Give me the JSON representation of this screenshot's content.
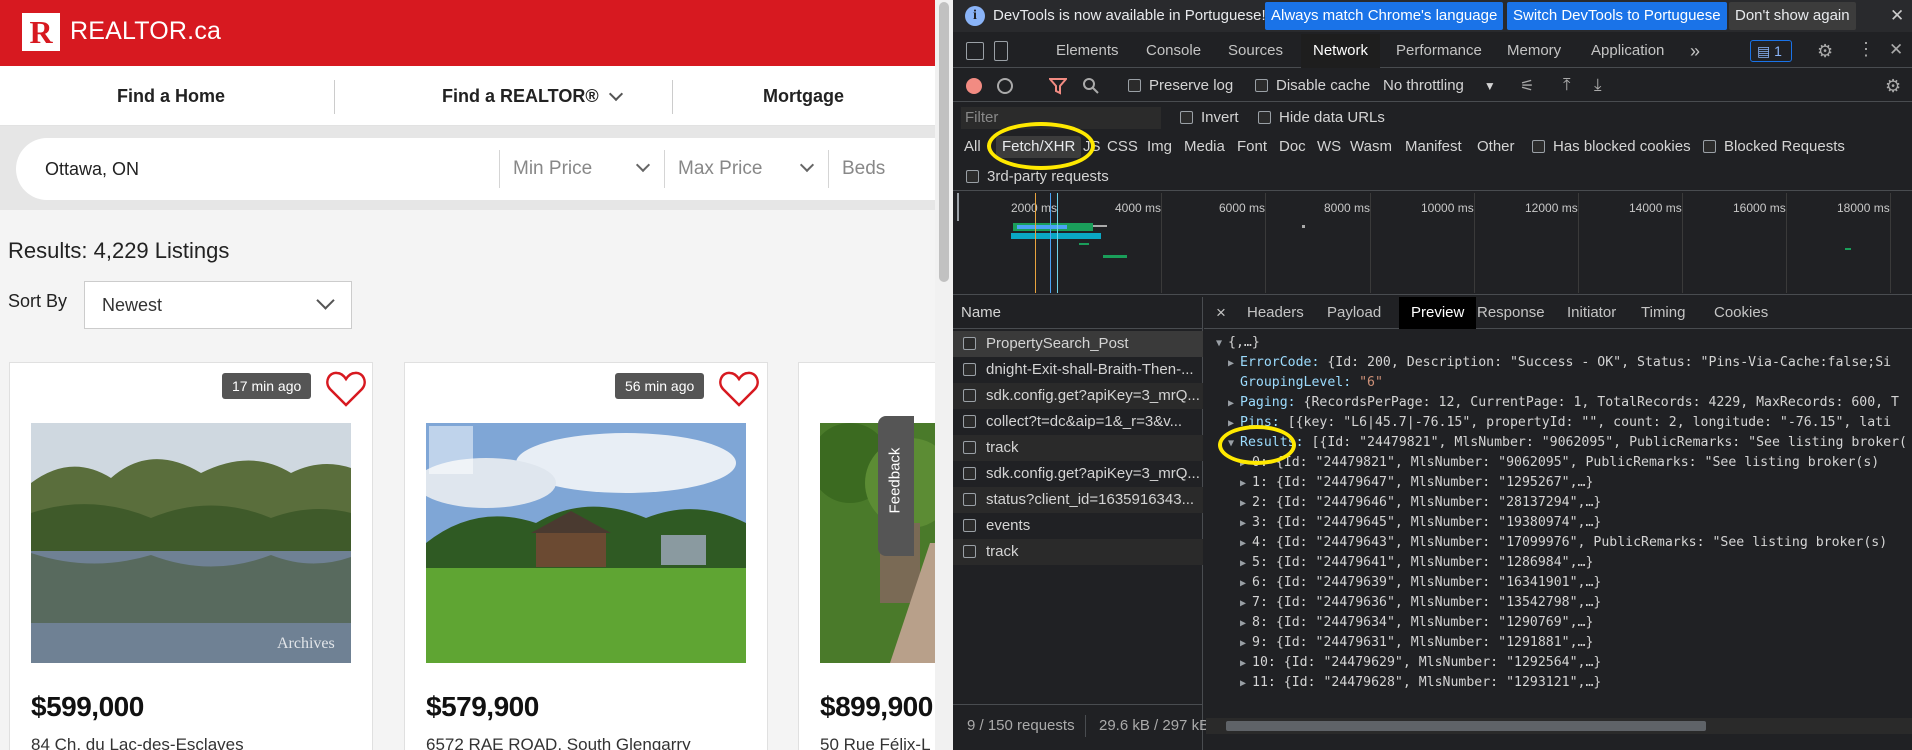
{
  "site": {
    "logo_letter": "R",
    "logo_text": "REALTOR.ca",
    "nav": [
      "Find a Home",
      "Find a REALTOR®",
      "Mortgage Calculators"
    ],
    "search": {
      "location": "Ottawa, ON",
      "min_price": "Min Price",
      "max_price": "Max Price",
      "beds": "Beds"
    },
    "results_label": "Results:",
    "results_count": "4,229 Listings",
    "sort_by_label": "Sort By",
    "sort_value": "Newest",
    "feedback": "Feedback",
    "listings": [
      {
        "time": "17 min ago",
        "price": "$599,000",
        "address": "84 Ch. du Lac-des-Esclaves",
        "watermark": "Archives"
      },
      {
        "time": "56 min ago",
        "price": "$579,900",
        "address": "6572 RAE ROAD, South Glengarry"
      },
      {
        "time": "",
        "price": "$899,900",
        "address": "50 Rue Félix-L"
      }
    ]
  },
  "devtools": {
    "info_icon": "i",
    "info_message": "DevTools is now available in Portuguese!",
    "btn_match": "Always match Chrome's language",
    "btn_switch": "Switch DevTools to Portuguese",
    "btn_dont_show": "Don't show again",
    "tabs": [
      "Elements",
      "Console",
      "Sources",
      "Network",
      "Performance",
      "Memory",
      "Application"
    ],
    "more_tabs": "»",
    "issues_count": "1",
    "preserve_log": "Preserve log",
    "disable_cache": "Disable cache",
    "throttling": "No throttling",
    "filter_placeholder": "Filter",
    "invert": "Invert",
    "hide_data_urls": "Hide data URLs",
    "types": [
      "All",
      "Fetch/XHR",
      "JS",
      "CSS",
      "Img",
      "Media",
      "Font",
      "Doc",
      "WS",
      "Wasm",
      "Manifest",
      "Other"
    ],
    "has_blocked_cookies": "Has blocked cookies",
    "blocked_requests": "Blocked Requests",
    "third_party": "3rd-party requests",
    "timeline_labels": [
      "2000 ms",
      "4000 ms",
      "6000 ms",
      "8000 ms",
      "10000 ms",
      "12000 ms",
      "14000 ms",
      "16000 ms",
      "18000 ms"
    ],
    "name_header": "Name",
    "requests": [
      "PropertySearch_Post",
      "dnight-Exit-shall-Braith-Then-...",
      "sdk.config.get?apiKey=3_mrQ...",
      "collect?t=dc&aip=1&_r=3&v...",
      "track",
      "sdk.config.get?apiKey=3_mrQ...",
      "status?client_id=1635916343...",
      "events",
      "track"
    ],
    "status_requests": "9 / 150 requests",
    "status_size": "29.6 kB / 297 kB",
    "detail_close": "×",
    "detail_tabs": [
      "Headers",
      "Payload",
      "Preview",
      "Response",
      "Initiator",
      "Timing",
      "Cookies"
    ],
    "preview": {
      "root": "{,…}",
      "error_code_key": "ErrorCode:",
      "error_code_val": "{Id: 200, Description: \"Success - OK\", Status: \"Pins-Via-Cache:false;Si",
      "grouping_key": "GroupingLevel:",
      "grouping_val": "\"6\"",
      "paging_key": "Paging:",
      "paging_val": "{RecordsPerPage: 12, CurrentPage: 1, TotalRecords: 4229, MaxRecords: 600, T",
      "pins_key": "Pins:",
      "pins_val": "[{key: \"L6|45.7|-76.15\", propertyId: \"\", count: 2, longitude: \"-76.15\", lati",
      "results_key": "Results:",
      "results_val": "[{Id: \"24479821\", MlsNumber: \"9062095\", PublicRemarks: \"See listing broker(",
      "rows": [
        "0: {Id: \"24479821\", MlsNumber: \"9062095\", PublicRemarks: \"See listing broker(s)",
        "1: {Id: \"24479647\", MlsNumber: \"1295267\",…}",
        "2: {Id: \"24479646\", MlsNumber: \"28137294\",…}",
        "3: {Id: \"24479645\", MlsNumber: \"19380974\",…}",
        "4: {Id: \"24479643\", MlsNumber: \"17099976\", PublicRemarks: \"See listing broker(s)",
        "5: {Id: \"24479641\", MlsNumber: \"1286984\",…}",
        "6: {Id: \"24479639\", MlsNumber: \"16341901\",…}",
        "7: {Id: \"24479636\", MlsNumber: \"13542798\",…}",
        "8: {Id: \"24479634\", MlsNumber: \"1290769\",…}",
        "9: {Id: \"24479631\", MlsNumber: \"1291881\",…}",
        "10: {Id: \"24479629\", MlsNumber: \"1292564\",…}",
        "11: {Id: \"24479628\", MlsNumber: \"1293121\",…}"
      ]
    }
  },
  "colors": {
    "brand_red": "#d71920",
    "devtools_bg": "#202124",
    "highlight_yellow": "#ffe900",
    "link_blue": "#1a73e8"
  }
}
